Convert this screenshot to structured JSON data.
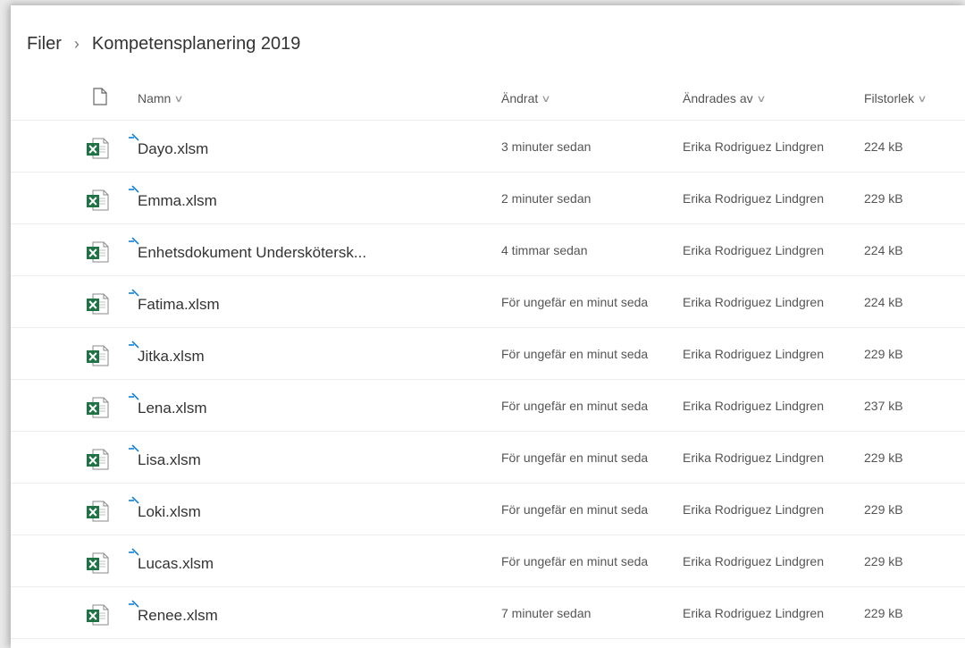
{
  "breadcrumb": {
    "root": "Filer",
    "current": "Kompetensplanering 2019"
  },
  "columns": {
    "name": "Namn",
    "modified": "Ändrat",
    "modified_by": "Ändrades av",
    "size": "Filstorlek"
  },
  "icons": {
    "file_type_header": "document-icon",
    "row": "excel-file-icon",
    "new_badge": "new-item-icon",
    "sort": "chevron-down-icon"
  },
  "colors": {
    "excel_green": "#1f7244",
    "new_badge_blue": "#0078d4"
  },
  "files": [
    {
      "name": "Dayo.xlsm",
      "modified": "3 minuter sedan",
      "modified_by": "Erika Rodriguez Lindgren",
      "size": "224 kB"
    },
    {
      "name": "Emma.xlsm",
      "modified": "2 minuter sedan",
      "modified_by": "Erika Rodriguez Lindgren",
      "size": "229 kB"
    },
    {
      "name": "Enhetsdokument Underskötersk...",
      "modified": "4 timmar sedan",
      "modified_by": "Erika Rodriguez Lindgren",
      "size": "224 kB"
    },
    {
      "name": "Fatima.xlsm",
      "modified": "För ungefär en minut seda",
      "modified_by": "Erika Rodriguez Lindgren",
      "size": "224 kB"
    },
    {
      "name": "Jitka.xlsm",
      "modified": "För ungefär en minut seda",
      "modified_by": "Erika Rodriguez Lindgren",
      "size": "229 kB"
    },
    {
      "name": "Lena.xlsm",
      "modified": "För ungefär en minut seda",
      "modified_by": "Erika Rodriguez Lindgren",
      "size": "237 kB"
    },
    {
      "name": "Lisa.xlsm",
      "modified": "För ungefär en minut seda",
      "modified_by": "Erika Rodriguez Lindgren",
      "size": "229 kB"
    },
    {
      "name": "Loki.xlsm",
      "modified": "För ungefär en minut seda",
      "modified_by": "Erika Rodriguez Lindgren",
      "size": "229 kB"
    },
    {
      "name": "Lucas.xlsm",
      "modified": "För ungefär en minut seda",
      "modified_by": "Erika Rodriguez Lindgren",
      "size": "229 kB"
    },
    {
      "name": "Renee.xlsm",
      "modified": "7 minuter sedan",
      "modified_by": "Erika Rodriguez Lindgren",
      "size": "229 kB"
    }
  ]
}
